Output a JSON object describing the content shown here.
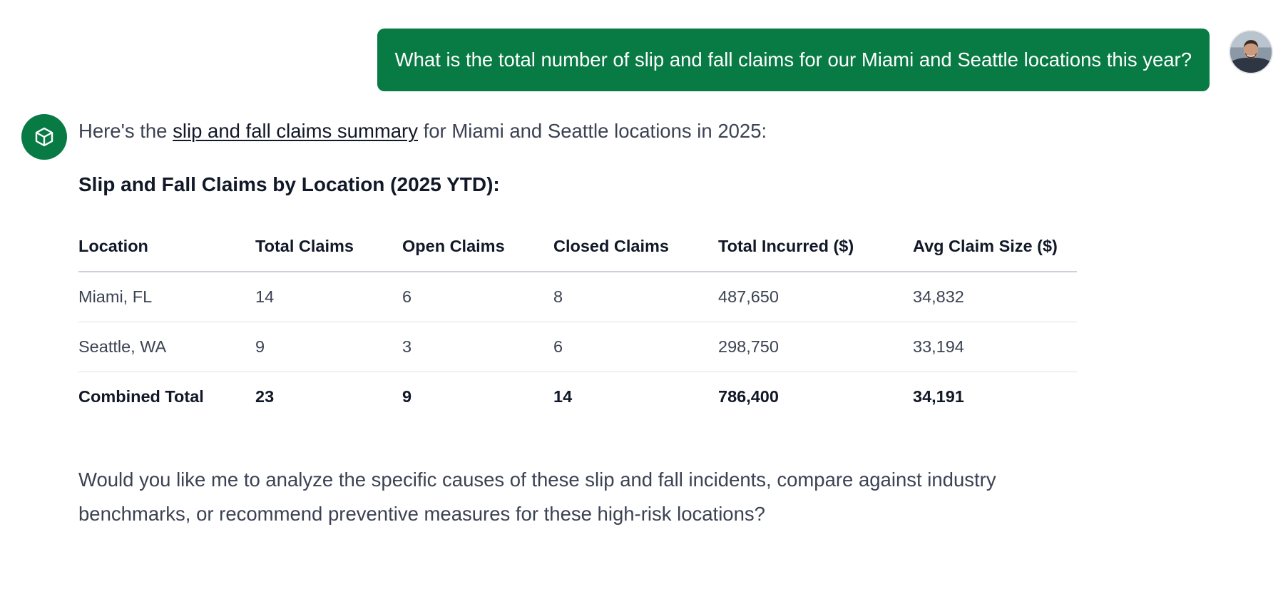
{
  "user_message": {
    "text": "What is the total number of slip and fall claims for our Miami and Seattle locations this year?",
    "avatar_icon": "user-photo-avatar"
  },
  "assistant": {
    "avatar_icon": "cube-icon",
    "intro_prefix": "Here's the ",
    "intro_link": "slip and fall claims summary",
    "intro_suffix": " for Miami and Seattle locations in 2025:",
    "section_title": "Slip and Fall Claims by Location (2025 YTD):",
    "table": {
      "headers": [
        "Location",
        "Total Claims",
        "Open Claims",
        "Closed Claims",
        "Total Incurred ($)",
        "Avg Claim Size ($)"
      ],
      "rows": [
        [
          "Miami, FL",
          "14",
          "6",
          "8",
          "487,650",
          "34,832"
        ],
        [
          "Seattle, WA",
          "9",
          "3",
          "6",
          "298,750",
          "33,194"
        ]
      ],
      "total_row": [
        "Combined Total",
        "23",
        "9",
        "14",
        "786,400",
        "34,191"
      ]
    },
    "closing": "Would you like me to analyze the specific causes of these slip and fall incidents, compare against industry benchmarks, or recommend preventive measures for these high-risk locations?"
  },
  "colors": {
    "accent_green": "#087a44",
    "text_primary": "#111827",
    "text_body": "#3b4252"
  }
}
